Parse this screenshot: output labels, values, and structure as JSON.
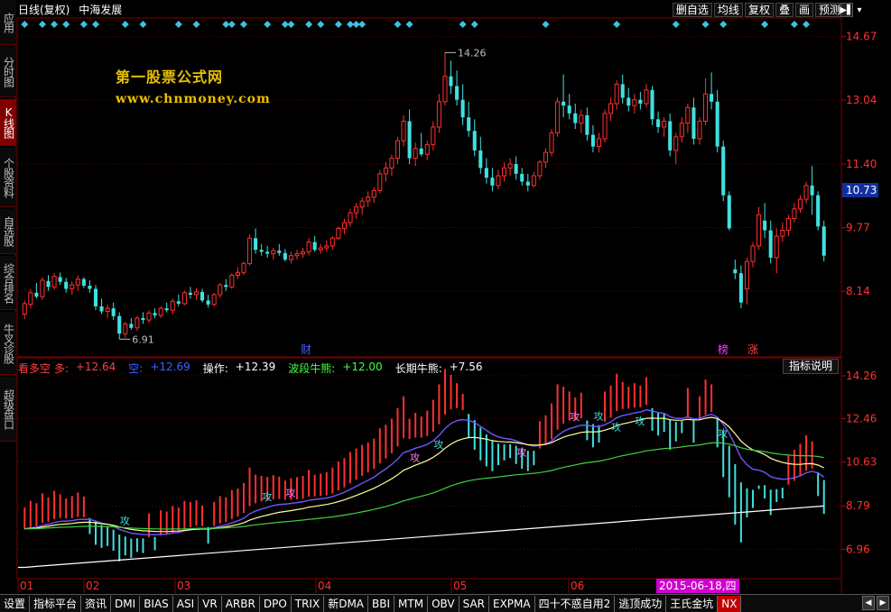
{
  "sidebar": {
    "items": [
      {
        "label": "应用",
        "active": false
      },
      {
        "label": "分时图",
        "active": false
      },
      {
        "label": "K线图",
        "active": true
      },
      {
        "label": "个股资料",
        "active": false
      },
      {
        "label": "自选股",
        "active": false
      },
      {
        "label": "综合排名",
        "active": false
      },
      {
        "label": "牛叉诊股",
        "active": false
      },
      {
        "label": "超级盘口",
        "active": false
      }
    ]
  },
  "title": {
    "period": "日线(复权)",
    "stock_name": "中海发展"
  },
  "toolbar": {
    "buttons": [
      "删自选",
      "均线",
      "复权",
      "叠",
      "画",
      "预测"
    ]
  },
  "watermark": {
    "title": "第一股票公式网",
    "url": "www.chnmoney.com"
  },
  "price_axis": {
    "labels": [
      "14.67",
      "13.04",
      "11.40",
      "10.73",
      "9.77",
      "8.14"
    ],
    "highlight": "10.73"
  },
  "annotations": {
    "high": "14.26",
    "low": "6.91",
    "events": [
      "财",
      "榜",
      "涨"
    ]
  },
  "indicator": {
    "header": [
      {
        "text": "看多空 多:",
        "color": "#ff4040"
      },
      {
        "text": "+12.64",
        "color": "#ff4040"
      },
      {
        "text": "空:",
        "color": "#4060ff"
      },
      {
        "text": "+12.69",
        "color": "#4060ff"
      },
      {
        "text": "操作:",
        "color": "#ffffff"
      },
      {
        "text": "+12.39",
        "color": "#ffffff"
      },
      {
        "text": "波段牛熊:",
        "color": "#40ff40"
      },
      {
        "text": "+12.00",
        "color": "#40ff40"
      },
      {
        "text": "长期牛熊:",
        "color": "#ffffff"
      },
      {
        "text": "+7.56",
        "color": "#ffffff"
      }
    ],
    "button": "指标说明",
    "axis_labels": [
      "14.26",
      "12.46",
      "10.63",
      "8.79",
      "6.96"
    ],
    "signal_text": "攻"
  },
  "x_axis": {
    "labels": [
      "01",
      "02",
      "03",
      "04",
      "05",
      "06"
    ],
    "tooltip": "2015-06-18,四"
  },
  "bottom_tabs": {
    "items": [
      "设置",
      "指标平台",
      "资讯",
      "DMI",
      "BIAS",
      "ASI",
      "VR",
      "ARBR",
      "DPO",
      "TRIX",
      "新DMA",
      "BBI",
      "MTM",
      "OBV",
      "SAR",
      "EXPMA",
      "四十不惑自用2",
      "逃顶成功",
      "王氏金坑",
      "NX"
    ],
    "active": "NX"
  },
  "chart_data": {
    "type": "candlestick",
    "price_range": [
      6.5,
      15.1
    ],
    "ohlc": [
      [
        7.55,
        7.9,
        7.42,
        7.82
      ],
      [
        7.8,
        8.2,
        7.7,
        8.1
      ],
      [
        8.1,
        8.35,
        7.95,
        8.0
      ],
      [
        8.0,
        8.5,
        7.92,
        8.42
      ],
      [
        8.4,
        8.55,
        8.15,
        8.25
      ],
      [
        8.25,
        8.6,
        8.18,
        8.52
      ],
      [
        8.5,
        8.62,
        8.3,
        8.38
      ],
      [
        8.38,
        8.48,
        8.1,
        8.2
      ],
      [
        8.2,
        8.4,
        8.05,
        8.3
      ],
      [
        8.3,
        8.55,
        8.15,
        8.45
      ],
      [
        8.45,
        8.5,
        8.22,
        8.28
      ],
      [
        8.28,
        8.42,
        8.1,
        8.2
      ],
      [
        8.2,
        8.3,
        7.65,
        7.75
      ],
      [
        7.75,
        7.95,
        7.55,
        7.62
      ],
      [
        7.62,
        7.8,
        7.45,
        7.7
      ],
      [
        7.7,
        7.85,
        7.4,
        7.5
      ],
      [
        7.5,
        7.6,
        6.91,
        7.05
      ],
      [
        7.05,
        7.35,
        6.95,
        7.3
      ],
      [
        7.3,
        7.45,
        7.15,
        7.2
      ],
      [
        7.2,
        7.5,
        7.12,
        7.45
      ],
      [
        7.45,
        7.6,
        7.3,
        7.4
      ],
      [
        7.4,
        7.65,
        7.32,
        7.58
      ],
      [
        7.58,
        7.7,
        7.45,
        7.52
      ],
      [
        7.52,
        7.75,
        7.45,
        7.7
      ],
      [
        7.7,
        7.85,
        7.6,
        7.65
      ],
      [
        7.65,
        7.95,
        7.55,
        7.88
      ],
      [
        7.88,
        8.05,
        7.75,
        7.82
      ],
      [
        7.82,
        8.15,
        7.78,
        8.1
      ],
      [
        8.1,
        8.25,
        7.95,
        8.05
      ],
      [
        8.05,
        8.22,
        7.92,
        8.12
      ],
      [
        8.12,
        8.2,
        7.85,
        7.9
      ],
      [
        7.9,
        8.05,
        7.72,
        7.8
      ],
      [
        7.8,
        8.1,
        7.75,
        8.05
      ],
      [
        8.05,
        8.35,
        7.98,
        8.3
      ],
      [
        8.3,
        8.45,
        8.15,
        8.25
      ],
      [
        8.25,
        8.6,
        8.2,
        8.55
      ],
      [
        8.55,
        8.75,
        8.45,
        8.62
      ],
      [
        8.62,
        8.9,
        8.55,
        8.85
      ],
      [
        8.85,
        9.6,
        8.8,
        9.5
      ],
      [
        9.5,
        9.75,
        9.1,
        9.2
      ],
      [
        9.2,
        9.35,
        9.05,
        9.15
      ],
      [
        9.15,
        9.3,
        9.0,
        9.1
      ],
      [
        9.1,
        9.25,
        8.95,
        9.18
      ],
      [
        9.18,
        9.35,
        9.05,
        9.12
      ],
      [
        9.12,
        9.22,
        8.9,
        8.95
      ],
      [
        8.95,
        9.15,
        8.85,
        9.05
      ],
      [
        9.05,
        9.2,
        8.95,
        9.1
      ],
      [
        9.1,
        9.25,
        9.0,
        9.15
      ],
      [
        9.15,
        9.5,
        9.05,
        9.4
      ],
      [
        9.4,
        9.55,
        9.15,
        9.2
      ],
      [
        9.2,
        9.35,
        9.1,
        9.25
      ],
      [
        9.25,
        9.45,
        9.15,
        9.3
      ],
      [
        9.3,
        9.55,
        9.2,
        9.5
      ],
      [
        9.5,
        9.8,
        9.45,
        9.75
      ],
      [
        9.75,
        10.0,
        9.6,
        9.9
      ],
      [
        9.9,
        10.25,
        9.8,
        10.15
      ],
      [
        10.15,
        10.4,
        10.0,
        10.3
      ],
      [
        10.3,
        10.55,
        10.1,
        10.45
      ],
      [
        10.45,
        10.7,
        10.3,
        10.55
      ],
      [
        10.55,
        10.8,
        10.4,
        10.72
      ],
      [
        10.72,
        11.25,
        10.65,
        11.15
      ],
      [
        11.15,
        11.45,
        10.95,
        11.3
      ],
      [
        11.3,
        11.65,
        11.1,
        11.55
      ],
      [
        11.55,
        12.1,
        11.4,
        12.0
      ],
      [
        12.0,
        12.65,
        11.85,
        12.5
      ],
      [
        12.5,
        12.8,
        11.4,
        11.55
      ],
      [
        11.55,
        11.95,
        11.35,
        11.8
      ],
      [
        11.8,
        12.2,
        11.6,
        11.65
      ],
      [
        11.65,
        12.0,
        11.5,
        11.9
      ],
      [
        11.9,
        12.5,
        11.75,
        12.35
      ],
      [
        12.35,
        13.2,
        12.2,
        13.0
      ],
      [
        13.0,
        14.26,
        12.9,
        13.65
      ],
      [
        13.65,
        14.05,
        13.2,
        13.4
      ],
      [
        13.4,
        13.8,
        12.9,
        13.05
      ],
      [
        13.05,
        13.45,
        12.4,
        12.6
      ],
      [
        12.6,
        13.0,
        12.1,
        12.25
      ],
      [
        12.25,
        12.55,
        11.6,
        11.75
      ],
      [
        11.75,
        12.1,
        11.15,
        11.3
      ],
      [
        11.3,
        11.55,
        10.9,
        11.05
      ],
      [
        11.05,
        11.3,
        10.7,
        10.85
      ],
      [
        10.85,
        11.25,
        10.75,
        11.1
      ],
      [
        11.1,
        11.45,
        10.95,
        11.3
      ],
      [
        11.3,
        11.55,
        11.1,
        11.4
      ],
      [
        11.4,
        11.6,
        11.0,
        11.15
      ],
      [
        11.15,
        11.3,
        10.85,
        10.95
      ],
      [
        10.95,
        11.15,
        10.7,
        10.85
      ],
      [
        10.85,
        11.2,
        10.8,
        11.1
      ],
      [
        11.1,
        11.5,
        11.0,
        11.45
      ],
      [
        11.45,
        11.8,
        11.3,
        11.7
      ],
      [
        11.7,
        12.3,
        11.6,
        12.2
      ],
      [
        12.2,
        13.1,
        12.1,
        13.0
      ],
      [
        13.0,
        13.7,
        12.6,
        12.9
      ],
      [
        12.9,
        13.2,
        12.55,
        12.7
      ],
      [
        12.7,
        12.95,
        12.3,
        12.45
      ],
      [
        12.45,
        12.8,
        12.2,
        12.65
      ],
      [
        12.65,
        12.85,
        12.0,
        12.15
      ],
      [
        12.15,
        12.4,
        11.7,
        11.85
      ],
      [
        11.85,
        12.2,
        11.7,
        12.05
      ],
      [
        12.05,
        12.8,
        11.95,
        12.7
      ],
      [
        12.7,
        13.1,
        12.5,
        12.95
      ],
      [
        12.95,
        13.55,
        12.8,
        13.45
      ],
      [
        13.45,
        13.7,
        12.95,
        13.1
      ],
      [
        13.1,
        13.35,
        12.75,
        12.9
      ],
      [
        12.9,
        13.2,
        12.7,
        13.05
      ],
      [
        13.05,
        13.25,
        12.8,
        12.95
      ],
      [
        12.95,
        13.45,
        12.85,
        13.3
      ],
      [
        13.3,
        13.4,
        12.4,
        12.55
      ],
      [
        12.55,
        12.75,
        12.2,
        12.35
      ],
      [
        12.35,
        12.6,
        12.1,
        12.5
      ],
      [
        12.5,
        12.7,
        11.6,
        11.75
      ],
      [
        11.75,
        12.2,
        11.4,
        12.1
      ],
      [
        12.1,
        12.6,
        11.95,
        12.45
      ],
      [
        12.45,
        12.95,
        12.2,
        12.85
      ],
      [
        12.85,
        13.1,
        11.9,
        12.05
      ],
      [
        12.05,
        12.6,
        11.9,
        12.5
      ],
      [
        12.5,
        13.6,
        12.4,
        13.2
      ],
      [
        13.2,
        13.75,
        12.8,
        13.0
      ],
      [
        13.0,
        13.3,
        11.7,
        11.85
      ],
      [
        11.85,
        12.0,
        10.45,
        10.6
      ],
      [
        10.6,
        10.7,
        9.7,
        9.75
      ],
      [
        8.7,
        8.95,
        8.45,
        8.6
      ],
      [
        8.6,
        8.8,
        7.7,
        7.85
      ],
      [
        8.2,
        9.0,
        7.8,
        8.9
      ],
      [
        8.9,
        9.4,
        8.75,
        9.3
      ],
      [
        9.3,
        10.3,
        9.2,
        10.1
      ],
      [
        9.95,
        10.4,
        9.5,
        9.7
      ],
      [
        9.7,
        9.95,
        8.85,
        9.0
      ],
      [
        9.0,
        9.75,
        8.6,
        9.55
      ],
      [
        9.55,
        9.9,
        9.4,
        9.7
      ],
      [
        9.7,
        10.1,
        9.55,
        10.0
      ],
      [
        10.0,
        10.4,
        9.9,
        10.25
      ],
      [
        10.25,
        10.6,
        10.15,
        10.5
      ],
      [
        10.5,
        10.95,
        10.4,
        10.85
      ],
      [
        10.85,
        11.35,
        10.1,
        10.6
      ],
      [
        10.6,
        10.7,
        9.7,
        9.8
      ],
      [
        9.8,
        9.95,
        8.9,
        9.05
      ]
    ]
  }
}
